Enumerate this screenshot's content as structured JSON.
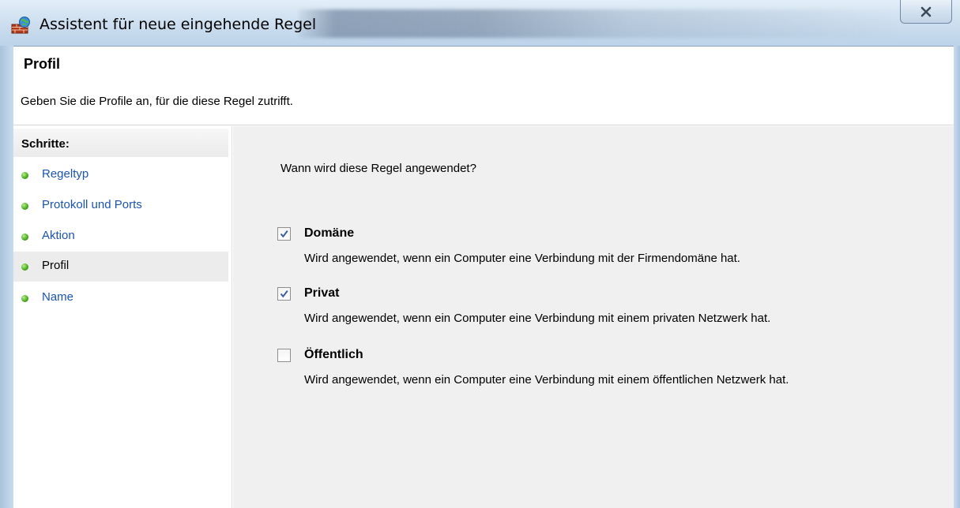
{
  "window": {
    "title": "Assistent für neue eingehende Regel",
    "close_symbol": "✕"
  },
  "header": {
    "title": "Profil",
    "subtitle": "Geben Sie die Profile an, für die diese Regel zutrifft."
  },
  "steps": {
    "heading": "Schritte:",
    "items": [
      {
        "label": "Regeltyp",
        "active": false
      },
      {
        "label": "Protokoll und Ports",
        "active": false
      },
      {
        "label": "Aktion",
        "active": false
      },
      {
        "label": "Profil",
        "active": true
      },
      {
        "label": "Name",
        "active": false
      }
    ]
  },
  "main": {
    "question": "Wann wird diese Regel angewendet?",
    "options": [
      {
        "label": "Domäne",
        "checked": true,
        "description": "Wird angewendet, wenn ein Computer eine Verbindung mit der Firmendomäne hat."
      },
      {
        "label": "Privat",
        "checked": true,
        "description": "Wird angewendet, wenn ein Computer eine Verbindung mit einem privaten Netzwerk hat."
      },
      {
        "label": "Öffentlich",
        "checked": false,
        "description": "Wird angewendet, wenn ein Computer eine Verbindung mit einem öffentlichen Netzwerk hat."
      }
    ]
  },
  "icons": {
    "app": "firewall-icon",
    "close": "close-icon",
    "step_status": "green-dot-icon",
    "checkmark": "checkmark-icon"
  }
}
